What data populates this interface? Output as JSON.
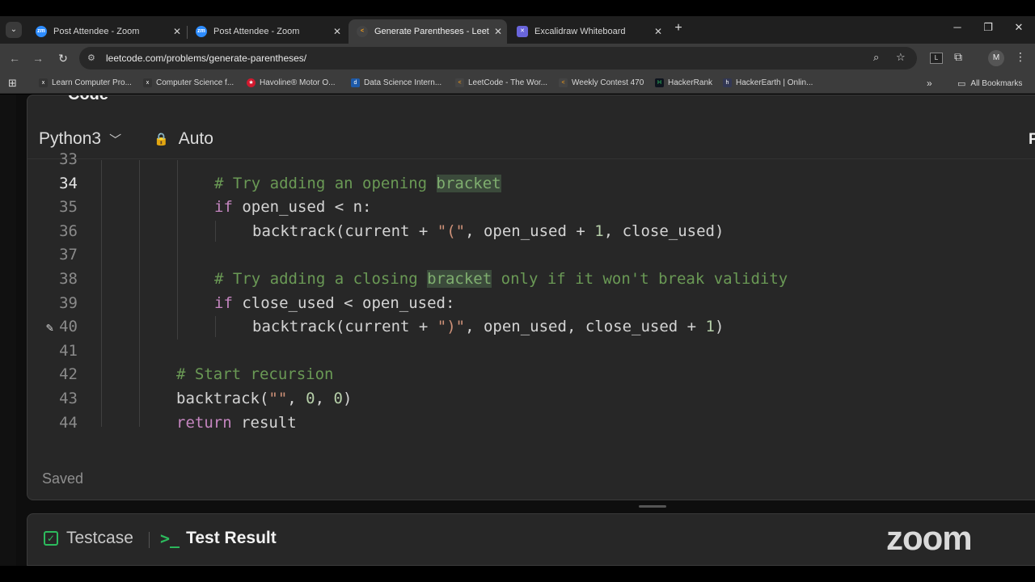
{
  "tabs": [
    {
      "title": "Post Attendee - Zoom",
      "icon": "zoom-icon",
      "color": "#2d8cff",
      "active": false
    },
    {
      "title": "Post Attendee - Zoom",
      "icon": "zoom-icon",
      "color": "#2d8cff",
      "active": false
    },
    {
      "title": "Generate Parentheses - LeetCo",
      "icon": "leetcode-icon",
      "color": "#ffa116",
      "active": true
    },
    {
      "title": "Excalidraw Whiteboard",
      "icon": "excalidraw-icon",
      "color": "#6965db",
      "active": false
    }
  ],
  "address_bar": {
    "url": "leetcode.com/problems/generate-parentheses/"
  },
  "bookmarks": {
    "items": [
      "Learn Computer Pro...",
      "Computer Science f...",
      "Havoline® Motor O...",
      "Data Science Intern...",
      "LeetCode - The Wor...",
      "Weekly Contest 470",
      "HackerRank",
      "HackerEarth | Onlin..."
    ],
    "all_label": "All Bookmarks"
  },
  "editor": {
    "header_clip": "Code",
    "language": "Python3",
    "mode": "Auto",
    "right_clip": "P",
    "status": "Saved"
  },
  "code_lines": [
    {
      "num": "33"
    },
    {
      "num": "34"
    },
    {
      "num": "35"
    },
    {
      "num": "36"
    },
    {
      "num": "37"
    },
    {
      "num": "38"
    },
    {
      "num": "39"
    },
    {
      "num": "40"
    },
    {
      "num": "41"
    },
    {
      "num": "42"
    },
    {
      "num": "43"
    },
    {
      "num": "44"
    }
  ],
  "code_text": {
    "l34_comment": "# Try adding an opening ",
    "l34_hl": "bracket",
    "l35_kw": "if",
    "l35_rest": " open_used < n:",
    "l36_a": "backtrack(current + ",
    "l36_str": "\"(\"",
    "l36_b": ", open_used + ",
    "l36_num": "1",
    "l36_c": ", close_used)",
    "l38_comment_a": "# Try adding a closing ",
    "l38_hl": "bracket",
    "l38_comment_b": " only if it won't break validity",
    "l39_kw": "if",
    "l39_rest": " close_used < open_used:",
    "l40_a": "backtrack(current + ",
    "l40_str": "\")\"",
    "l40_b": ", open_used, close_used + ",
    "l40_num": "1",
    "l40_c": ")",
    "l42_comment": "# Start recursion",
    "l43_a": "backtrack(",
    "l43_str": "\"\"",
    "l43_b": ", ",
    "l43_n1": "0",
    "l43_c": ", ",
    "l43_n2": "0",
    "l43_d": ")",
    "l44_kw": "return",
    "l44_rest": " result"
  },
  "bottom": {
    "testcase_label": "Testcase",
    "result_label": "Test Result",
    "zoom_logo": "zoom"
  }
}
